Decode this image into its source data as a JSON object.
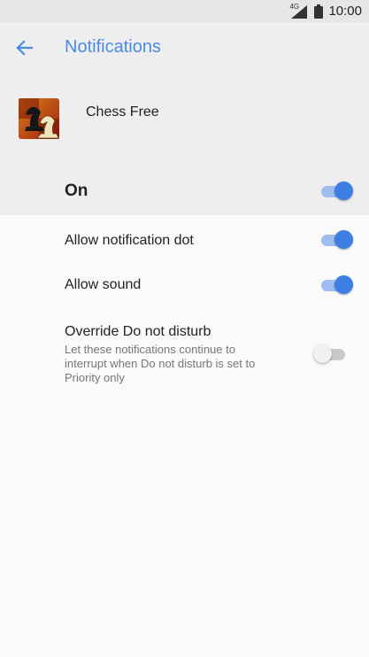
{
  "status_bar": {
    "network": "4G",
    "time": "10:00"
  },
  "header": {
    "title": "Notifications",
    "app_name": "Chess Free"
  },
  "master": {
    "label": "On",
    "enabled": true
  },
  "settings": [
    {
      "label": "Allow notification dot",
      "enabled": true
    },
    {
      "label": "Allow sound",
      "enabled": true
    },
    {
      "label": "Override Do not disturb",
      "description": "Let these notifications continue to interrupt when Do not disturb is set to Priority only",
      "enabled": false
    }
  ],
  "colors": {
    "accent": "#4a8be6",
    "switch_on": "#3d7ee3",
    "header_bg": "#eeeeee",
    "page_bg": "#fafafa"
  }
}
